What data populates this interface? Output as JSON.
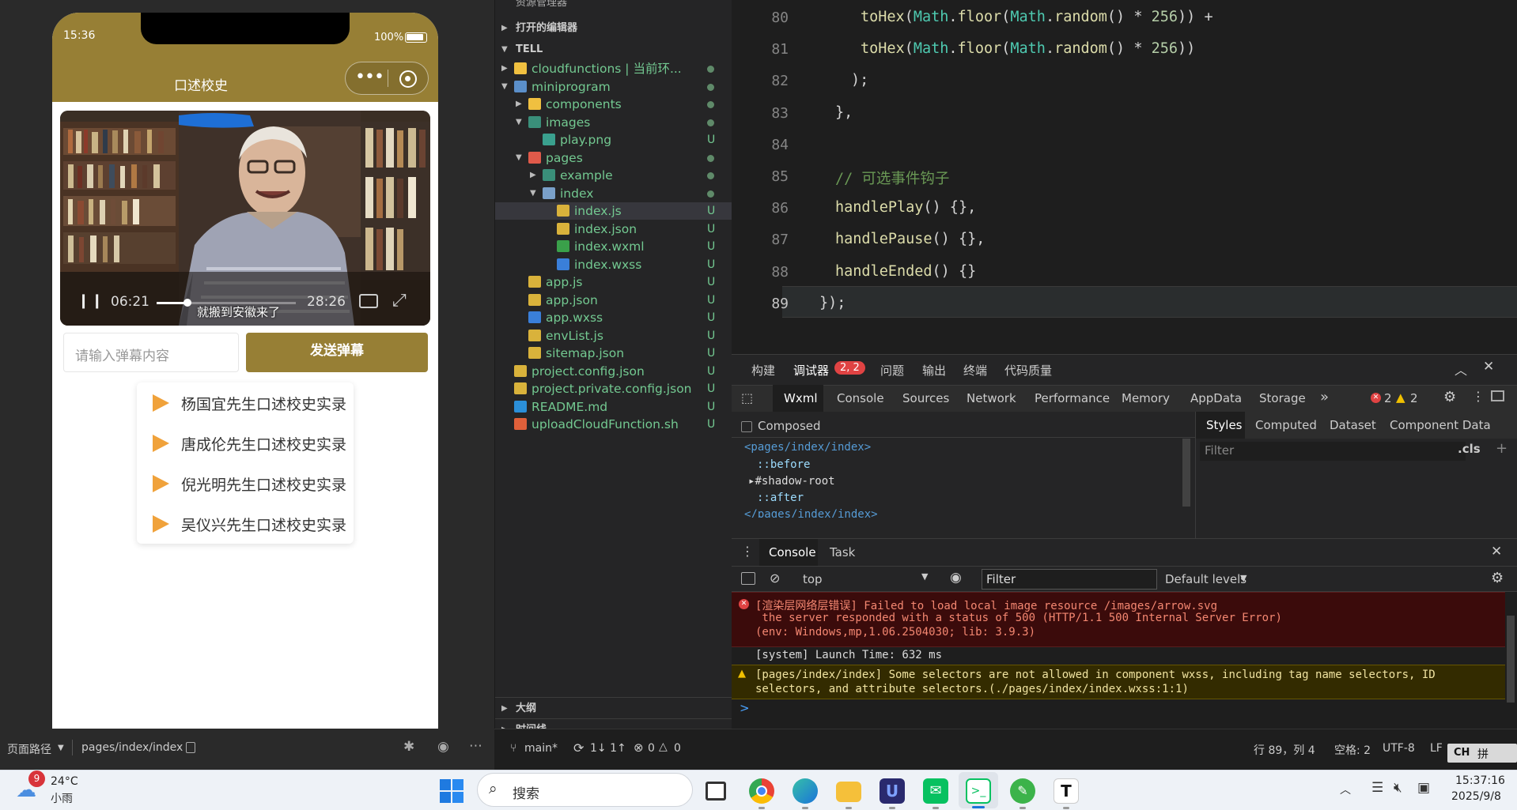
{
  "simulator": {
    "time": "15:36",
    "battery": "100%",
    "page_title": "口述校史",
    "video": {
      "current": "06:21",
      "duration": "28:26",
      "subtitle": "就搬到安徽来了",
      "progress": 0.22
    },
    "danmu_placeholder": "请输入弹幕内容",
    "danmu_button": "发送弹幕",
    "list": [
      "杨国宜先生口述校史实录",
      "唐成伦先生口述校史实录",
      "倪光明先生口述校史实录",
      "吴仪兴先生口述校史实录"
    ],
    "path_label": "页面路径",
    "path": "pages/index/index"
  },
  "explorer": {
    "top_partial": "资源管理器",
    "open_editors": "打开的编辑器",
    "project": "TELL",
    "items": [
      {
        "name": "cloudfunctions | 当前环...",
        "badge": "dot"
      },
      {
        "name": "miniprogram",
        "badge": "dot"
      },
      {
        "name": "components",
        "badge": "dot"
      },
      {
        "name": "images",
        "badge": "dot"
      },
      {
        "name": "play.png",
        "badge": "U"
      },
      {
        "name": "pages",
        "badge": "dot"
      },
      {
        "name": "example",
        "badge": "dot"
      },
      {
        "name": "index",
        "badge": "dot"
      },
      {
        "name": "index.js",
        "badge": "U"
      },
      {
        "name": "index.json",
        "badge": "U"
      },
      {
        "name": "index.wxml",
        "badge": "U"
      },
      {
        "name": "index.wxss",
        "badge": "U"
      },
      {
        "name": "app.js",
        "badge": "U"
      },
      {
        "name": "app.json",
        "badge": "U"
      },
      {
        "name": "app.wxss",
        "badge": "U"
      },
      {
        "name": "envList.js",
        "badge": "U"
      },
      {
        "name": "sitemap.json",
        "badge": "U"
      },
      {
        "name": "project.config.json",
        "badge": "U"
      },
      {
        "name": "project.private.config.json",
        "badge": "U"
      },
      {
        "name": "README.md",
        "badge": "U"
      },
      {
        "name": "uploadCloudFunction.sh",
        "badge": "U"
      }
    ],
    "outline": "大纲",
    "timeline": "时间线"
  },
  "editor": {
    "lines": [
      {
        "n": "80",
        "text": "toHex(Math.floor(Math.random() * 256)) +"
      },
      {
        "n": "81",
        "text": "toHex(Math.floor(Math.random() * 256))"
      },
      {
        "n": "82",
        "text": ");"
      },
      {
        "n": "83",
        "text": "},"
      },
      {
        "n": "84",
        "text": ""
      },
      {
        "n": "85",
        "text": "// 可选事件钩子"
      },
      {
        "n": "86",
        "text": "handlePlay() {},"
      },
      {
        "n": "87",
        "text": "handlePause() {},"
      },
      {
        "n": "88",
        "text": "handleEnded() {}"
      },
      {
        "n": "89",
        "text": "});"
      }
    ]
  },
  "debugger": {
    "top_tabs": [
      "构建",
      "调试器",
      "问题",
      "输出",
      "终端",
      "代码质量"
    ],
    "debugger_badge": "2, 2",
    "dev_tabs": [
      "Wxml",
      "Console",
      "Sources",
      "Network",
      "Performance",
      "Memory",
      "AppData",
      "Storage"
    ],
    "more": "»",
    "err_count": "2",
    "warn_count": "2",
    "composed": "Composed",
    "style_tabs": [
      "Styles",
      "Computed",
      "Dataset",
      "Component Data"
    ],
    "filter": "Filter",
    "cls": ".cls",
    "plus": "+",
    "wxml_lines": [
      "<pages/index/index>",
      "::before",
      "#shadow-root",
      "::after",
      "</pages/index/index>"
    ],
    "console_tabs": [
      "Console",
      "Task"
    ],
    "context": "top",
    "filter_placeholder": "Filter",
    "levels": "Default levels",
    "error_lines": [
      "[渲染层网络层错误] Failed to load local image resource /images/arrow.svg",
      " the server responded with a status of 500 (HTTP/1.1 500 Internal Server Error)",
      "(env: Windows,mp,1.06.2504030; lib: 3.9.3)"
    ],
    "system_line": "[system] Launch Time: 632 ms",
    "warn_lines": [
      "[pages/index/index] Some selectors are not allowed in component wxss, including tag name selectors, ID",
      "selectors, and attribute selectors.(./pages/index/index.wxss:1:1)"
    ],
    "prompt": ">"
  },
  "statusbar": {
    "branch": "main*",
    "sync": "1↓ 1↑",
    "errors": "0",
    "warnings": "0",
    "position": "行 89，列 4",
    "spaces": "空格: 2",
    "encoding": "UTF-8",
    "eol": "LF",
    "ime1": "CH",
    "ime2": "拼"
  },
  "taskbar": {
    "weather_badge": "9",
    "temp": "24°C",
    "weather": "小雨",
    "search": "搜索",
    "time": "15:37:16",
    "date": "2025/9/8"
  },
  "colors": {
    "brand": "#977f35",
    "accent_tab": "#e04343",
    "git_untracked": "#73c991"
  }
}
